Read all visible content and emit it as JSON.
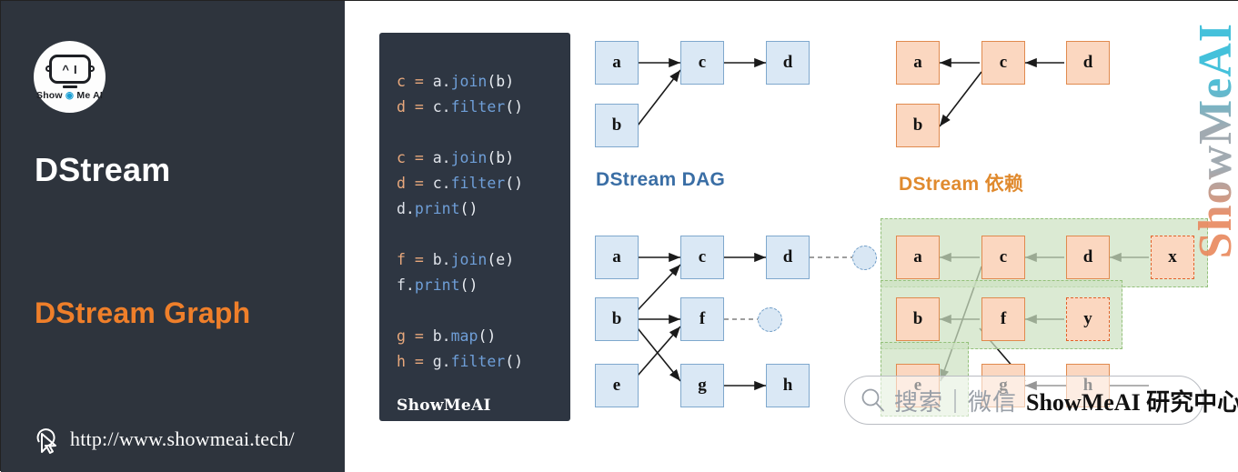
{
  "left_panel": {
    "logo": {
      "glyph_a": "^",
      "glyph_i": "I",
      "text_before": "Show ",
      "text_o": "◉",
      "text_after": " Me AI"
    },
    "title_main": "DStream",
    "title_sub": "DStream Graph",
    "footer_url": "http://www.showmeai.tech/"
  },
  "code_card": {
    "brand": "ShowMeAI",
    "lines": [
      {
        "var": "c",
        "op": " = ",
        "obj": "a.",
        "fn": "join",
        "args": "(b)"
      },
      {
        "var": "d",
        "op": " = ",
        "obj": "c.",
        "fn": "filter",
        "args": "()"
      },
      {
        "blank": true
      },
      {
        "var": "c",
        "op": " = ",
        "obj": "a.",
        "fn": "join",
        "args": "(b)"
      },
      {
        "var": "d",
        "op": " = ",
        "obj": "c.",
        "fn": "filter",
        "args": "()"
      },
      {
        "var": "",
        "op": "",
        "obj": "d.",
        "fn": "print",
        "args": "()"
      },
      {
        "blank": true
      },
      {
        "var": "f",
        "op": " = ",
        "obj": "b.",
        "fn": "join",
        "args": "(e)"
      },
      {
        "var": "",
        "op": "",
        "obj": "f.",
        "fn": "print",
        "args": "()"
      },
      {
        "blank": true
      },
      {
        "var": "g",
        "op": " = ",
        "obj": "b.",
        "fn": "map",
        "args": "()"
      },
      {
        "var": "h",
        "op": " = ",
        "obj": "g.",
        "fn": "filter",
        "args": "()"
      }
    ]
  },
  "diagrams": {
    "dag_top": {
      "label": "DStream DAG",
      "label_color": "#3a6ea5",
      "nodes": [
        {
          "id": "a",
          "text": "a"
        },
        {
          "id": "b",
          "text": "b"
        },
        {
          "id": "c",
          "text": "c"
        },
        {
          "id": "d",
          "text": "d"
        }
      ],
      "edges": [
        "a->c",
        "b->c",
        "c->d"
      ]
    },
    "dep_top": {
      "label": "DStream 依赖",
      "label_color": "#e08a2e",
      "nodes": [
        {
          "id": "a",
          "text": "a"
        },
        {
          "id": "b",
          "text": "b"
        },
        {
          "id": "c",
          "text": "c"
        },
        {
          "id": "d",
          "text": "d"
        }
      ],
      "edges": [
        "c->a",
        "c->b",
        "d->c"
      ]
    },
    "dag_bottom": {
      "nodes": [
        {
          "id": "a",
          "text": "a"
        },
        {
          "id": "b",
          "text": "b"
        },
        {
          "id": "e",
          "text": "e"
        },
        {
          "id": "c",
          "text": "c"
        },
        {
          "id": "f",
          "text": "f"
        },
        {
          "id": "g",
          "text": "g"
        },
        {
          "id": "d",
          "text": "d"
        },
        {
          "id": "h",
          "text": "h"
        }
      ],
      "output_circles": 2,
      "edges": [
        "a->c",
        "b->c",
        "c->d",
        "b->f",
        "e->f",
        "b->g",
        "g->h"
      ]
    },
    "dep_bottom": {
      "nodes": [
        {
          "id": "a",
          "text": "a"
        },
        {
          "id": "b",
          "text": "b"
        },
        {
          "id": "e",
          "text": "e"
        },
        {
          "id": "c",
          "text": "c"
        },
        {
          "id": "f",
          "text": "f"
        },
        {
          "id": "g",
          "text": "g"
        },
        {
          "id": "d",
          "text": "d"
        },
        {
          "id": "h",
          "text": "h"
        },
        {
          "id": "x",
          "text": "x"
        },
        {
          "id": "y",
          "text": "y"
        }
      ],
      "edges": [
        "c->a",
        "d->c",
        "x->d",
        "c->e",
        "f->b",
        "y->f",
        "f->g",
        "h->g"
      ],
      "highlight_bands": 3
    }
  },
  "watermarks": {
    "vertical": "ShowMeAI",
    "search_cn": "搜索｜微信",
    "search_brand": "ShowMeAI 研究中心"
  }
}
